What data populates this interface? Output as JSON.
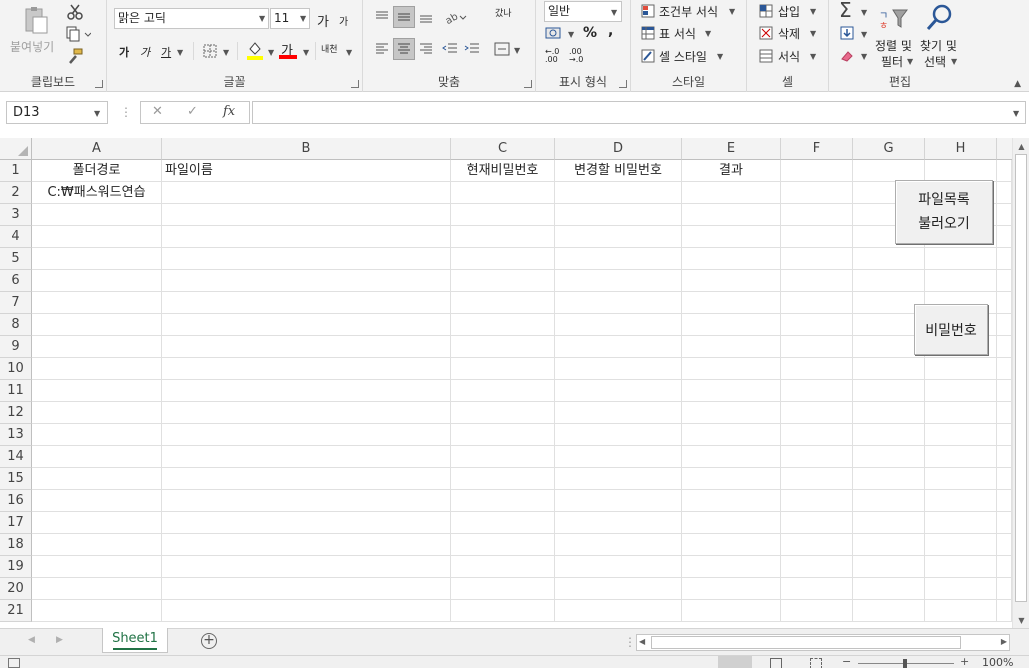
{
  "ribbon": {
    "clipboard": {
      "paste_label": "붙여넣기",
      "group_label": "클립보드"
    },
    "font": {
      "font_name": "맑은 고딕",
      "font_size": "11",
      "grow_label": "가",
      "shrink_label": "가",
      "bold_label": "가",
      "italic_label": "가",
      "underline_label": "가",
      "font_color_label": "가",
      "phonetic_label": "내천",
      "group_label": "글꼴"
    },
    "alignment": {
      "wrap_label": "갔나",
      "group_label": "맞춤"
    },
    "number": {
      "format_value": "일반",
      "percent_label": "%",
      "comma_label": ",",
      "inc_decimal_label": "←.0 .00",
      "dec_decimal_label": ".00 →.0",
      "group_label": "표시 형식"
    },
    "styles": {
      "conditional_label": "조건부 서식",
      "table_label": "표 서식",
      "cell_style_label": "셀 스타일",
      "group_label": "스타일"
    },
    "cells": {
      "insert_label": "삽입",
      "delete_label": "삭제",
      "format_label": "서식",
      "group_label": "셀"
    },
    "editing": {
      "sort_label_1": "정렬 및",
      "sort_label_2": "필터",
      "find_label_1": "찾기 및",
      "find_label_2": "선택",
      "group_label": "편집"
    }
  },
  "formula_bar": {
    "name_box": "D13",
    "fx_label": "fx",
    "cancel_label": "✕",
    "enter_label": "✓",
    "formula": ""
  },
  "sheet": {
    "columns": [
      "A",
      "B",
      "C",
      "D",
      "E",
      "F",
      "G",
      "H"
    ],
    "rows": [
      "1",
      "2",
      "3",
      "4",
      "5",
      "6",
      "7",
      "8",
      "9",
      "10",
      "11",
      "12",
      "13",
      "14",
      "15",
      "16",
      "17",
      "18",
      "19",
      "20",
      "21"
    ],
    "cells": {
      "A1": "폴더경로",
      "B1": "파일이름",
      "C1": "현재비밀번호",
      "D1": "변경할 비밀번호",
      "E1": "결과",
      "A2": "C:₩패스워드연습"
    },
    "buttons": {
      "load_files_line1": "파일목록",
      "load_files_line2": "불러오기",
      "password": "비밀번호"
    }
  },
  "tabs": {
    "sheet1": "Sheet1",
    "add_label": "+"
  },
  "status": {
    "zoom": "100%"
  }
}
